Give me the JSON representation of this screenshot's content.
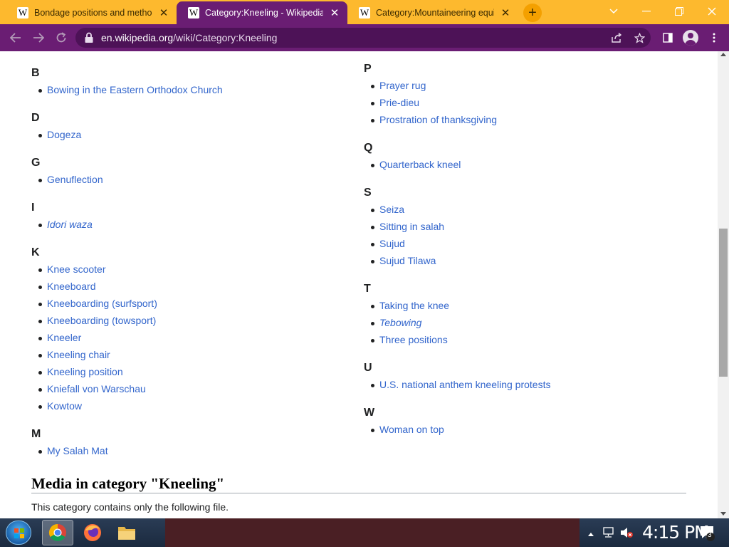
{
  "browser": {
    "tabs": [
      {
        "title": "Bondage positions and methods",
        "active": false
      },
      {
        "title": "Category:Kneeling - Wikipedia",
        "active": true
      },
      {
        "title": "Category:Mountaineering equip",
        "active": false
      }
    ],
    "favicon_letter": "W",
    "close_glyph": "✕",
    "new_tab_glyph": "+",
    "url_host": "en.wikipedia.org",
    "url_path": "/wiki/Category:Kneeling"
  },
  "page": {
    "left_column": [
      {
        "letter": "B",
        "items": [
          {
            "text": "Bowing in the Eastern Orthodox Church"
          }
        ]
      },
      {
        "letter": "D",
        "items": [
          {
            "text": "Dogeza"
          }
        ]
      },
      {
        "letter": "G",
        "items": [
          {
            "text": "Genuflection"
          }
        ]
      },
      {
        "letter": "I",
        "items": [
          {
            "text": "Idori waza",
            "italic": true
          }
        ]
      },
      {
        "letter": "K",
        "items": [
          {
            "text": "Knee scooter"
          },
          {
            "text": "Kneeboard"
          },
          {
            "text": "Kneeboarding (surfsport)"
          },
          {
            "text": "Kneeboarding (towsport)"
          },
          {
            "text": "Kneeler"
          },
          {
            "text": "Kneeling chair"
          },
          {
            "text": "Kneeling position"
          },
          {
            "text": "Kniefall von Warschau"
          },
          {
            "text": "Kowtow"
          }
        ]
      },
      {
        "letter": "M",
        "items": [
          {
            "text": "My Salah Mat"
          }
        ]
      }
    ],
    "right_column": [
      {
        "letter": "P",
        "items": [
          {
            "text": "Prayer rug"
          },
          {
            "text": "Prie-dieu"
          },
          {
            "text": "Prostration of thanksgiving"
          }
        ]
      },
      {
        "letter": "Q",
        "items": [
          {
            "text": "Quarterback kneel"
          }
        ]
      },
      {
        "letter": "S",
        "items": [
          {
            "text": "Seiza"
          },
          {
            "text": "Sitting in salah"
          },
          {
            "text": "Sujud"
          },
          {
            "text": "Sujud Tilawa"
          }
        ]
      },
      {
        "letter": "T",
        "items": [
          {
            "text": "Taking the knee"
          },
          {
            "text": "Tebowing",
            "italic": true
          },
          {
            "text": "Three positions"
          }
        ]
      },
      {
        "letter": "U",
        "items": [
          {
            "text": "U.S. national anthem kneeling protests"
          }
        ]
      },
      {
        "letter": "W",
        "items": [
          {
            "text": "Woman on top"
          }
        ]
      }
    ],
    "media_heading": "Media in category \"Kneeling\"",
    "media_text": "This category contains only the following file."
  },
  "taskbar": {
    "clock": "4:15 PM",
    "notification_count": "3"
  },
  "colors": {
    "tab_strip": "#fdb92e",
    "theme": "#6a1d73",
    "link": "#3366cc"
  }
}
